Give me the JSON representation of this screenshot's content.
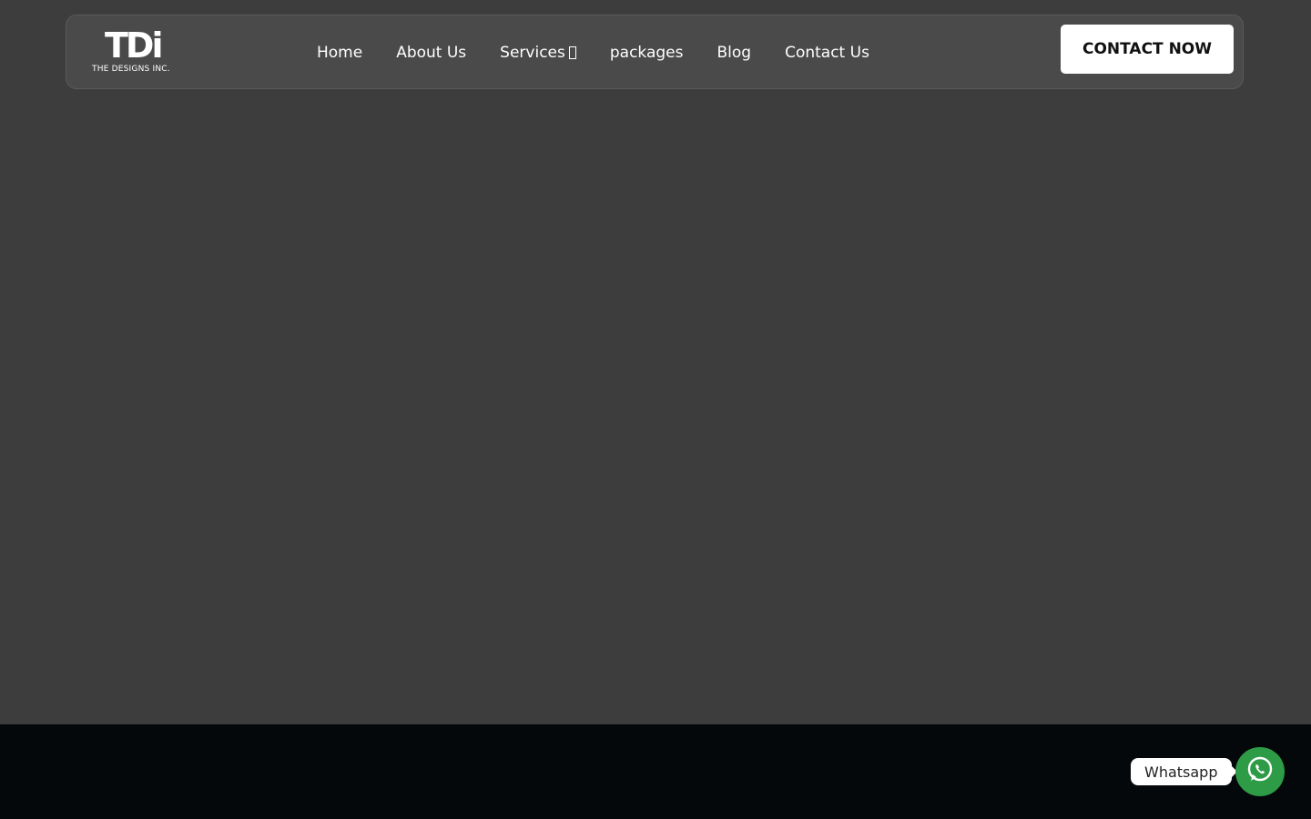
{
  "brand": {
    "logo_mark": "TDi",
    "logo_subtitle": "THE DESIGNS INC."
  },
  "nav": {
    "items": [
      {
        "label": "Home"
      },
      {
        "label": "About Us"
      },
      {
        "label": "Services",
        "has_dropdown": true
      },
      {
        "label": "packages"
      },
      {
        "label": "Blog"
      },
      {
        "label": "Contact Us"
      }
    ]
  },
  "header": {
    "cta_label": "CONTACT NOW"
  },
  "whatsapp": {
    "label": "Whatsapp",
    "icon": "whatsapp-icon"
  },
  "colors": {
    "hero_bg": "#3d3d3e",
    "navbar_bg": "#4a4a4a",
    "footer_bg": "#05080b",
    "cta_bg": "#ffffff",
    "whatsapp_green": "#2e9b47"
  }
}
